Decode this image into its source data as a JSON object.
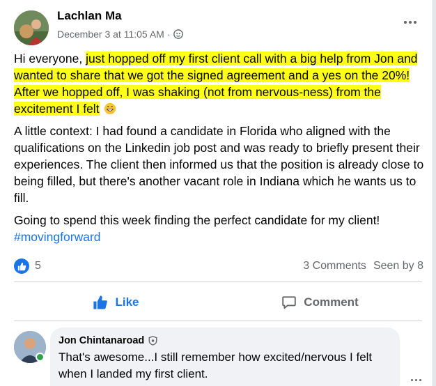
{
  "post": {
    "author": "Lachlan Ma",
    "date": "December 3 at 11:05 AM",
    "separator": " · ",
    "paragraph1_plain": "Hi everyone, ",
    "paragraph1_highlight": "just hopped off my first client call with a big help from Jon and wanted to share that we got the signed agreement and a yes on the 20%! After we hopped off, I was shaking (not from nervous-ness) from the excitement I felt",
    "paragraph2": "A little context: I had found a candidate in Florida who aligned with the qualifications on the Linkedin job post and was ready to briefly present their experiences. The client then informed us that the position is already close to being filled, but there's another vacant role in Indiana which he wants us to fill.",
    "paragraph3": "Going to spend this week finding the perfect candidate for my client!",
    "hashtag": "#movingforward"
  },
  "stats": {
    "like_count": "5",
    "comments": "3 Comments",
    "seen_by": "Seen by 8"
  },
  "actions": {
    "like_label": "Like",
    "comment_label": "Comment"
  },
  "comment": {
    "author": "Jon Chintanaroad",
    "text": "That's awesome...I still remember how excited/nervous I felt when I landed my first client."
  },
  "colors": {
    "accent": "#1b74e4",
    "highlight": "#ffff1a",
    "secondary_text": "#65676b",
    "online": "#31a24c"
  },
  "icons": [
    "globe-icon",
    "more-options-icon",
    "emoji-grin-icon",
    "like-reaction-icon",
    "thumbs-up-icon",
    "comment-icon",
    "shield-icon"
  ]
}
